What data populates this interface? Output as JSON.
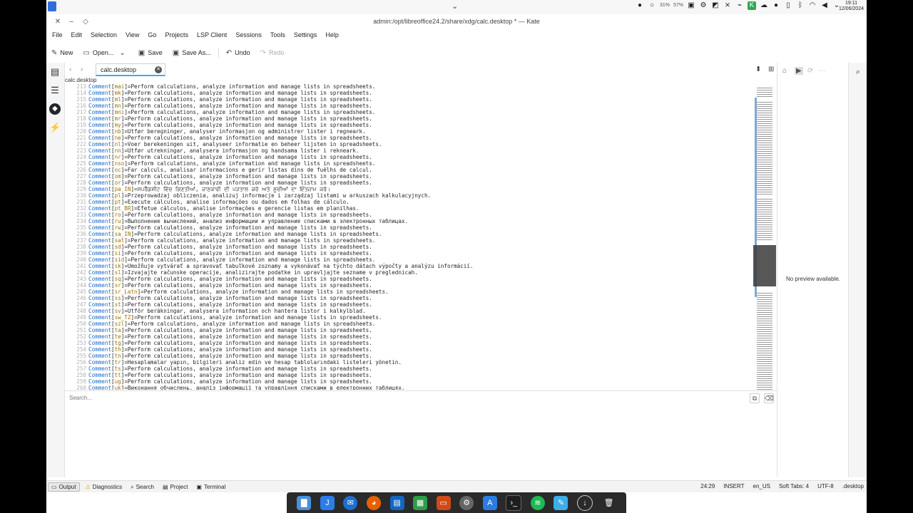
{
  "system": {
    "clock_time": "19:11",
    "clock_date": "12/06/2024",
    "tray_percent_a": "31%",
    "tray_percent_b": "57%"
  },
  "window": {
    "title": "admin:/opt/libreoffice24.2/share/xdg/calc.desktop * — Kate"
  },
  "menu": [
    "File",
    "Edit",
    "Selection",
    "View",
    "Go",
    "Projects",
    "LSP Client",
    "Sessions",
    "Tools",
    "Settings",
    "Help"
  ],
  "toolbar": {
    "new": "New",
    "open": "Open...",
    "save": "Save",
    "save_as": "Save As...",
    "undo": "Undo",
    "redo": "Redo"
  },
  "tab": {
    "label": "calc.desktop"
  },
  "breadcrumb": "calc.desktop",
  "editor": {
    "lines": [
      {
        "n": "213",
        "key": "Comment",
        "lang": "mai",
        "val": "Perform calculations, analyze information and manage lists in spreadsheets."
      },
      {
        "n": "214",
        "key": "Comment",
        "lang": "mk",
        "val": "Perform calculations, analyze information and manage lists in spreadsheets."
      },
      {
        "n": "215",
        "key": "Comment",
        "lang": "ml",
        "val": "Perform calculations, analyze information and manage lists in spreadsheets."
      },
      {
        "n": "216",
        "key": "Comment",
        "lang": "mn",
        "val": "Perform calculations, analyze information and manage lists in spreadsheets."
      },
      {
        "n": "217",
        "key": "Comment",
        "lang": "mni",
        "val": "Perform calculations, analyze information and manage lists in spreadsheets."
      },
      {
        "n": "218",
        "key": "Comment",
        "lang": "mr",
        "val": "Perform calculations, analyze information and manage lists in spreadsheets."
      },
      {
        "n": "219",
        "key": "Comment",
        "lang": "my",
        "val": "Perform calculations, analyze information and manage lists in spreadsheets."
      },
      {
        "n": "220",
        "key": "Comment",
        "lang": "nb",
        "val": "Utfør beregninger, analyser informasjon og administrer lister i regneark."
      },
      {
        "n": "221",
        "key": "Comment",
        "lang": "ne",
        "val": "Perform calculations, analyze information and manage lists in spreadsheets."
      },
      {
        "n": "222",
        "key": "Comment",
        "lang": "nl",
        "val": "Voer berekeningen uit, analyseer informatie en beheer lijsten in spreadsheets."
      },
      {
        "n": "223",
        "key": "Comment",
        "lang": "nn",
        "val": "Utfør utrekningar, analysera informasjon og handsama lister i rekneark."
      },
      {
        "n": "224",
        "key": "Comment",
        "lang": "nr",
        "val": "Perform calculations, analyze information and manage lists in spreadsheets."
      },
      {
        "n": "225",
        "key": "Comment",
        "lang": "nso",
        "val": "Perform calculations, analyze information and manage lists in spreadsheets."
      },
      {
        "n": "226",
        "key": "Comment",
        "lang": "oc",
        "val": "Far calculs, analisar informacions e gerir listas dins de fuèlhs de calcul."
      },
      {
        "n": "227",
        "key": "Comment",
        "lang": "om",
        "val": "Perform calculations, analyze information and manage lists in spreadsheets."
      },
      {
        "n": "228",
        "key": "Comment",
        "lang": "or",
        "val": "Perform calculations, analyze information and manage lists in spreadsheets."
      },
      {
        "n": "229",
        "key": "Comment",
        "lang": "pa_IN",
        "val": "ਸਪਰੈੱਡਸ਼ੀਟ ਵਿੱਚ ਗਿਣਤੀਆਂ, ਜਾਣਕਾਰੀ ਦੀ ਪੜਤਾਲ ਕਰੋ ਅਤੇ ਸੂਚੀਆਂ ਦਾ ਇੰਤਜ਼ਾਮ ਕਰੋ।"
      },
      {
        "n": "230",
        "key": "Comment",
        "lang": "pl",
        "val": "Przeprowadzaj obliczenia, analizuj informacje i zarządzaj listami w arkuszach kalkulacyjnych."
      },
      {
        "n": "231",
        "key": "Comment",
        "lang": "pt",
        "val": "Execute cálculos, analise informações ou dados em folhas de cálculo."
      },
      {
        "n": "232",
        "key": "Comment",
        "lang": "pt_BR",
        "val": "Efetue cálculos, analise informações e gerencie listas em planilhas."
      },
      {
        "n": "233",
        "key": "Comment",
        "lang": "ro",
        "val": "Perform calculations, analyze information and manage lists in spreadsheets."
      },
      {
        "n": "234",
        "key": "Comment",
        "lang": "ru",
        "val": "Выполнение вычислений, анализ информации и управление списками в электронных таблицах."
      },
      {
        "n": "235",
        "key": "Comment",
        "lang": "rw",
        "val": "Perform calculations, analyze information and manage lists in spreadsheets."
      },
      {
        "n": "236",
        "key": "Comment",
        "lang": "sa_IN",
        "val": "Perform calculations, analyze information and manage lists in spreadsheets."
      },
      {
        "n": "237",
        "key": "Comment",
        "lang": "sat",
        "val": "Perform calculations, analyze information and manage lists in spreadsheets."
      },
      {
        "n": "238",
        "key": "Comment",
        "lang": "sd",
        "val": "Perform calculations, analyze information and manage lists in spreadsheets."
      },
      {
        "n": "239",
        "key": "Comment",
        "lang": "si",
        "val": "Perform calculations, analyze information and manage lists in spreadsheets."
      },
      {
        "n": "240",
        "key": "Comment",
        "lang": "sid",
        "val": "Perform calculations, analyze information and manage lists in spreadsheets."
      },
      {
        "n": "241",
        "key": "Comment",
        "lang": "sk",
        "val": "Umožňuje vytvárať a spravovať tabuľkové zoznamy a vykonávať na týchto dátach výpočty a analýzu informácií."
      },
      {
        "n": "242",
        "key": "Comment",
        "lang": "sl",
        "val": "Izvajajte računske operacije, analizirajte podatke in upravljajte sezname v preglednicah."
      },
      {
        "n": "243",
        "key": "Comment",
        "lang": "sq",
        "val": "Perform calculations, analyze information and manage lists in spreadsheets."
      },
      {
        "n": "244",
        "key": "Comment",
        "lang": "sr",
        "val": "Perform calculations, analyze information and manage lists in spreadsheets."
      },
      {
        "n": "245",
        "key": "Comment",
        "lang": "sr_Latn",
        "val": "Perform calculations, analyze information and manage lists in spreadsheets."
      },
      {
        "n": "246",
        "key": "Comment",
        "lang": "ss",
        "val": "Perform calculations, analyze information and manage lists in spreadsheets."
      },
      {
        "n": "247",
        "key": "Comment",
        "lang": "st",
        "val": "Perform calculations, analyze information and manage lists in spreadsheets."
      },
      {
        "n": "248",
        "key": "Comment",
        "lang": "sv",
        "val": "Utför beräkningar, analysera information och hantera listor i kalkylblad."
      },
      {
        "n": "249",
        "key": "Comment",
        "lang": "sw_TZ",
        "val": "Perform calculations, analyze information and manage lists in spreadsheets."
      },
      {
        "n": "250",
        "key": "Comment",
        "lang": "szl",
        "val": "Perform calculations, analyze information and manage lists in spreadsheets."
      },
      {
        "n": "251",
        "key": "Comment",
        "lang": "ta",
        "val": "Perform calculations, analyze information and manage lists in spreadsheets."
      },
      {
        "n": "252",
        "key": "Comment",
        "lang": "te",
        "val": "Perform calculations, analyze information and manage lists in spreadsheets."
      },
      {
        "n": "253",
        "key": "Comment",
        "lang": "tg",
        "val": "Perform calculations, analyze information and manage lists in spreadsheets."
      },
      {
        "n": "254",
        "key": "Comment",
        "lang": "th",
        "val": "Perform calculations, analyze information and manage lists in spreadsheets."
      },
      {
        "n": "255",
        "key": "Comment",
        "lang": "tn",
        "val": "Perform calculations, analyze information and manage lists in spreadsheets."
      },
      {
        "n": "256",
        "key": "Comment",
        "lang": "tr",
        "val": "Hesaplamalar yapın, bilgileri analiz edin ve hesap tablolarındaki listeleri yönetin."
      },
      {
        "n": "257",
        "key": "Comment",
        "lang": "ts",
        "val": "Perform calculations, analyze information and manage lists in spreadsheets."
      },
      {
        "n": "258",
        "key": "Comment",
        "lang": "tt",
        "val": "Perform calculations, analyze information and manage lists in spreadsheets."
      },
      {
        "n": "259",
        "key": "Comment",
        "lang": "ug",
        "val": "Perform calculations, analyze information and manage lists in spreadsheets."
      },
      {
        "n": "260",
        "key": "Comment",
        "lang": "uk",
        "val": "Виконання обчислень, аналіз інформації та управління списками в електронних таблицях."
      }
    ]
  },
  "search": {
    "placeholder": "Search..."
  },
  "preview": {
    "message": "No preview available."
  },
  "status_tabs": [
    {
      "label": "Output",
      "icon": "output-icon",
      "active": true
    },
    {
      "label": "Diagnostics",
      "icon": "warning-icon",
      "active": false
    },
    {
      "label": "Search",
      "icon": "search-icon",
      "active": false
    },
    {
      "label": "Project",
      "icon": "project-icon",
      "active": false
    },
    {
      "label": "Terminal",
      "icon": "terminal-icon",
      "active": false
    }
  ],
  "status": {
    "cursor": "24:29",
    "mode": "INSERT",
    "dictionary": "en_US",
    "tabs": "Soft Tabs: 4",
    "encoding": "UTF-8",
    "filetype": ".desktop"
  },
  "colors": {
    "accent": "#3daee9",
    "key": "#1b6ac9",
    "locale": "#a07000"
  }
}
